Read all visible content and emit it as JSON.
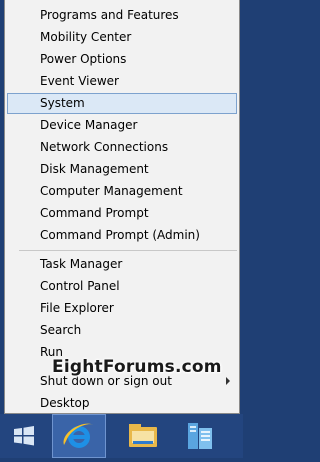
{
  "menu": {
    "items": [
      {
        "label": "Programs and Features"
      },
      {
        "label": "Mobility Center"
      },
      {
        "label": "Power Options"
      },
      {
        "label": "Event Viewer"
      },
      {
        "label": "System"
      },
      {
        "label": "Device Manager"
      },
      {
        "label": "Network Connections"
      },
      {
        "label": "Disk Management"
      },
      {
        "label": "Computer Management"
      },
      {
        "label": "Command Prompt"
      },
      {
        "label": "Command Prompt (Admin)"
      },
      {
        "label": "Task Manager"
      },
      {
        "label": "Control Panel"
      },
      {
        "label": "File Explorer"
      },
      {
        "label": "Search"
      },
      {
        "label": "Run"
      },
      {
        "label": "Shut down or sign out"
      },
      {
        "label": "Desktop"
      }
    ],
    "selected_label": "System"
  },
  "watermark": "EightForums.com",
  "taskbar": {
    "buttons": [
      {
        "icon": "windows-start-icon"
      },
      {
        "icon": "internet-explorer-icon"
      },
      {
        "icon": "file-explorer-icon"
      },
      {
        "icon": "server-manager-icon"
      }
    ]
  },
  "colors": {
    "menu_bg": "#f2f2f2",
    "selection_bg": "#dbe8f6",
    "selection_border": "#7da2ce",
    "taskbar_bg": "#23457f"
  }
}
